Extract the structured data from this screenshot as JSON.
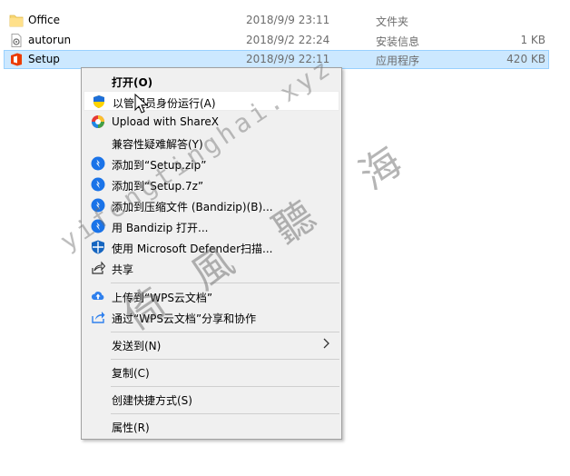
{
  "files": [
    {
      "name": "Office",
      "date": "2018/9/9 23:11",
      "type": "文件夹",
      "size": "",
      "icon": "folder-icon"
    },
    {
      "name": "autorun",
      "date": "2018/9/2 22:24",
      "type": "安装信息",
      "size": "1 KB",
      "icon": "settings-file-icon"
    },
    {
      "name": "Setup",
      "date": "2018/9/9 22:11",
      "type": "应用程序",
      "size": "420 KB",
      "icon": "office-setup-icon"
    }
  ],
  "menu": {
    "open": "打开(O)",
    "run_as_admin": "以管理员身份运行(A)",
    "sharex": "Upload with ShareX",
    "compat": "兼容性疑难解答(Y)",
    "add_zip": "添加到“Setup.zip”",
    "add_7z": "添加到“Setup.7z”",
    "add_archive": "添加到压缩文件 (Bandizip)(B)...",
    "open_bandizip": "用 Bandizip 打开...",
    "defender": "使用 Microsoft Defender扫描...",
    "share": "共享",
    "wps_upload": "上传到“WPS云文档”",
    "wps_share": "通过“WPS云文档”分享和协作",
    "send_to": "发送到(N)",
    "copy": "复制(C)",
    "shortcut": "创建快捷方式(S)",
    "properties": "属性(R)"
  },
  "watermark": {
    "latin": "yifengtinghai.xyz",
    "chars": [
      "海",
      "聽",
      "風",
      "倚"
    ]
  },
  "colors": {
    "selection_bg": "#cce8ff",
    "menu_bg": "#f0f0f0",
    "bandizip_blue": "#1a73e8"
  }
}
